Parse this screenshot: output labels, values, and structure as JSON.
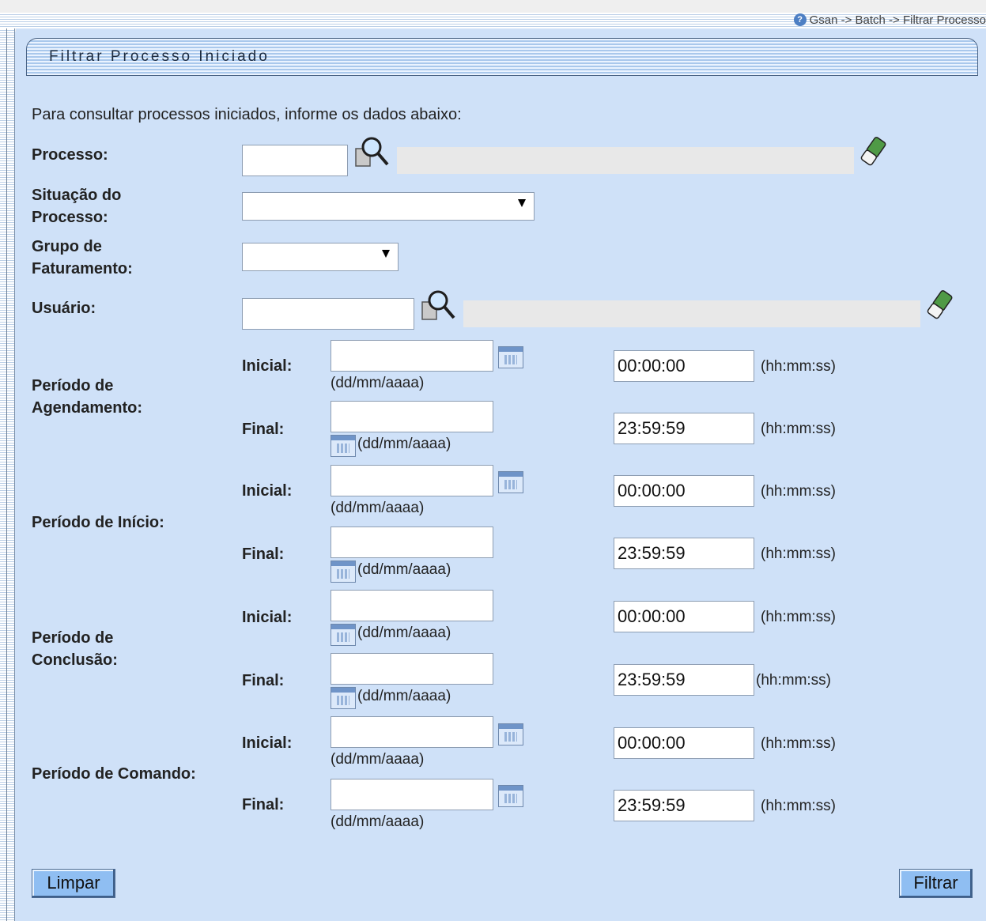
{
  "breadcrumb": "Gsan -> Batch -> Filtrar Processo",
  "title": "Filtrar Processo Iniciado",
  "intro": "Para consultar processos iniciados, informe os dados abaixo:",
  "fields": {
    "processo": {
      "label": "Processo:",
      "value": "",
      "description": ""
    },
    "situacao": {
      "label_line1": "Situação do",
      "label_line2": "Processo:",
      "selected": ""
    },
    "grupo": {
      "label_line1": "Grupo de",
      "label_line2": "Faturamento:",
      "selected": ""
    },
    "usuario": {
      "label": "Usuário:",
      "value": "",
      "description": ""
    }
  },
  "periods": [
    {
      "label_line1": "Período de",
      "label_line2": "Agendamento:",
      "inicial_label": "Inicial:",
      "final_label": "Final:",
      "date_format": "(dd/mm/aaaa)",
      "time_format": "(hh:mm:ss)",
      "time_inicial": "00:00:00",
      "time_final": "23:59:59"
    },
    {
      "label_line1": "Período de Início:",
      "label_line2": "",
      "inicial_label": "Inicial:",
      "final_label": "Final:",
      "date_format": "(dd/mm/aaaa)",
      "time_format": "(hh:mm:ss)",
      "time_inicial": "00:00:00",
      "time_final": "23:59:59"
    },
    {
      "label_line1": "Período de",
      "label_line2": "Conclusão:",
      "inicial_label": "Inicial:",
      "final_label": "Final:",
      "date_format": "(dd/mm/aaaa)",
      "time_format": "(hh:mm:ss)",
      "time_inicial": "00:00:00",
      "time_final": "23:59:59"
    },
    {
      "label_line1": "Período de Comando:",
      "label_line2": "",
      "inicial_label": "Inicial:",
      "final_label": "Final:",
      "date_format": "(dd/mm/aaaa)",
      "time_format": "(hh:mm:ss)",
      "time_inicial": "00:00:00",
      "time_final": "23:59:59"
    }
  ],
  "buttons": {
    "limpar": "Limpar",
    "filtrar": "Filtrar"
  },
  "icons": {
    "search": "magnifier-icon",
    "erase": "eraser-icon",
    "calendar": "calendar-icon",
    "help": "help-icon"
  },
  "colors": {
    "background": "#cfe1f8",
    "button": "#8fbef2",
    "readonly": "#e8e8e8"
  }
}
